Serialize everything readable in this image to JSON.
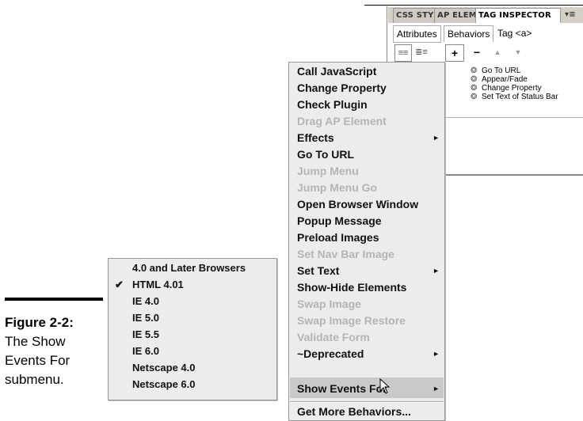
{
  "caption": {
    "title": "Figure 2-2:",
    "lines": [
      "The Show",
      "Events For",
      "submenu."
    ]
  },
  "panel": {
    "tabs": [
      "CSS STY",
      "AP ELEM",
      "TAG INSPECTOR"
    ],
    "subtabs": [
      "Attributes",
      "Behaviors",
      "Tag <a>"
    ],
    "toolbar": {
      "show_set_events": "≡≡",
      "show_all_events": "≣≡",
      "add": "+",
      "remove": "−",
      "up": "▲",
      "down": "▼"
    },
    "list": [
      "Go To URL",
      "Appear/Fade",
      "Change Property",
      "Set Text of Status Bar"
    ]
  },
  "menu": {
    "items": [
      {
        "label": "Call JavaScript",
        "disabled": false,
        "submenu": false
      },
      {
        "label": "Change Property",
        "disabled": false,
        "submenu": false
      },
      {
        "label": "Check Plugin",
        "disabled": false,
        "submenu": false
      },
      {
        "label": "Drag AP Element",
        "disabled": true,
        "submenu": false
      },
      {
        "label": "Effects",
        "disabled": false,
        "submenu": true
      },
      {
        "label": "Go To URL",
        "disabled": false,
        "submenu": false
      },
      {
        "label": "Jump Menu",
        "disabled": true,
        "submenu": false
      },
      {
        "label": "Jump Menu Go",
        "disabled": true,
        "submenu": false
      },
      {
        "label": "Open Browser Window",
        "disabled": false,
        "submenu": false
      },
      {
        "label": "Popup Message",
        "disabled": false,
        "submenu": false
      },
      {
        "label": "Preload Images",
        "disabled": false,
        "submenu": false
      },
      {
        "label": "Set Nav Bar Image",
        "disabled": true,
        "submenu": false
      },
      {
        "label": "Set Text",
        "disabled": false,
        "submenu": true
      },
      {
        "label": "Show-Hide Elements",
        "disabled": false,
        "submenu": false
      },
      {
        "label": "Swap Image",
        "disabled": true,
        "submenu": false
      },
      {
        "label": "Swap Image Restore",
        "disabled": true,
        "submenu": false
      },
      {
        "label": "Validate Form",
        "disabled": true,
        "submenu": false
      },
      {
        "label": "~Deprecated",
        "disabled": false,
        "submenu": true
      },
      {
        "label": "Show Events For",
        "disabled": false,
        "submenu": true
      },
      {
        "label": "Get More Behaviors...",
        "disabled": false,
        "submenu": false
      }
    ],
    "arrow": "►"
  },
  "submenu": {
    "items": [
      {
        "label": "4.0 and Later Browsers",
        "checked": false
      },
      {
        "label": "HTML 4.01",
        "checked": true
      },
      {
        "label": "IE 4.0",
        "checked": false
      },
      {
        "label": "IE 5.0",
        "checked": false
      },
      {
        "label": "IE 5.5",
        "checked": false
      },
      {
        "label": "IE 6.0",
        "checked": false
      },
      {
        "label": "Netscape 4.0",
        "checked": false
      },
      {
        "label": "Netscape 6.0",
        "checked": false
      }
    ],
    "check": "✔"
  },
  "icons": {
    "gear": "❂",
    "cursor": "mouse-pointer-icon"
  }
}
